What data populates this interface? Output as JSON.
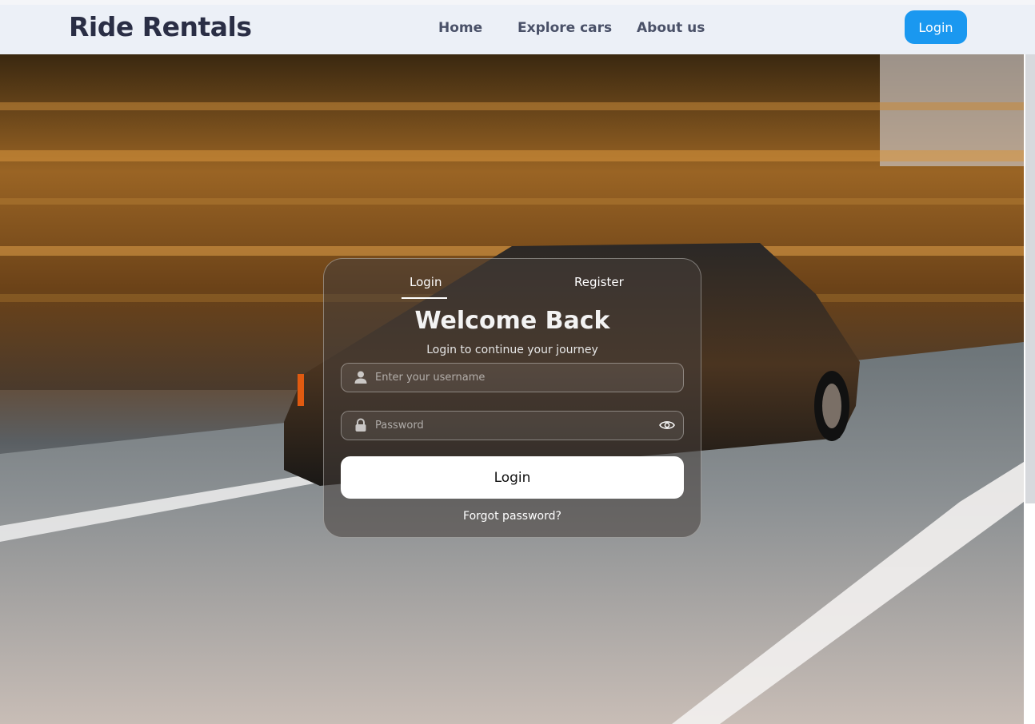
{
  "navbar": {
    "brand": "Ride Rentals",
    "links": [
      "Home",
      "Explore cars",
      "About us"
    ],
    "login_label": "Login"
  },
  "auth_card": {
    "tabs": [
      "Login",
      "Register"
    ],
    "active_tab": "Login",
    "title": "Welcome Back",
    "subtitle": "Login to continue your journey",
    "username_placeholder": "Enter your username",
    "password_placeholder": "Password",
    "submit_label": "Login",
    "forgot_label": "Forgot password?"
  },
  "colors": {
    "accent": "#1a98f0",
    "navbar_bg": "#ecf0f7",
    "brand_text": "#2a2e45"
  },
  "icons": [
    "user-icon",
    "lock-icon",
    "eye-icon"
  ]
}
